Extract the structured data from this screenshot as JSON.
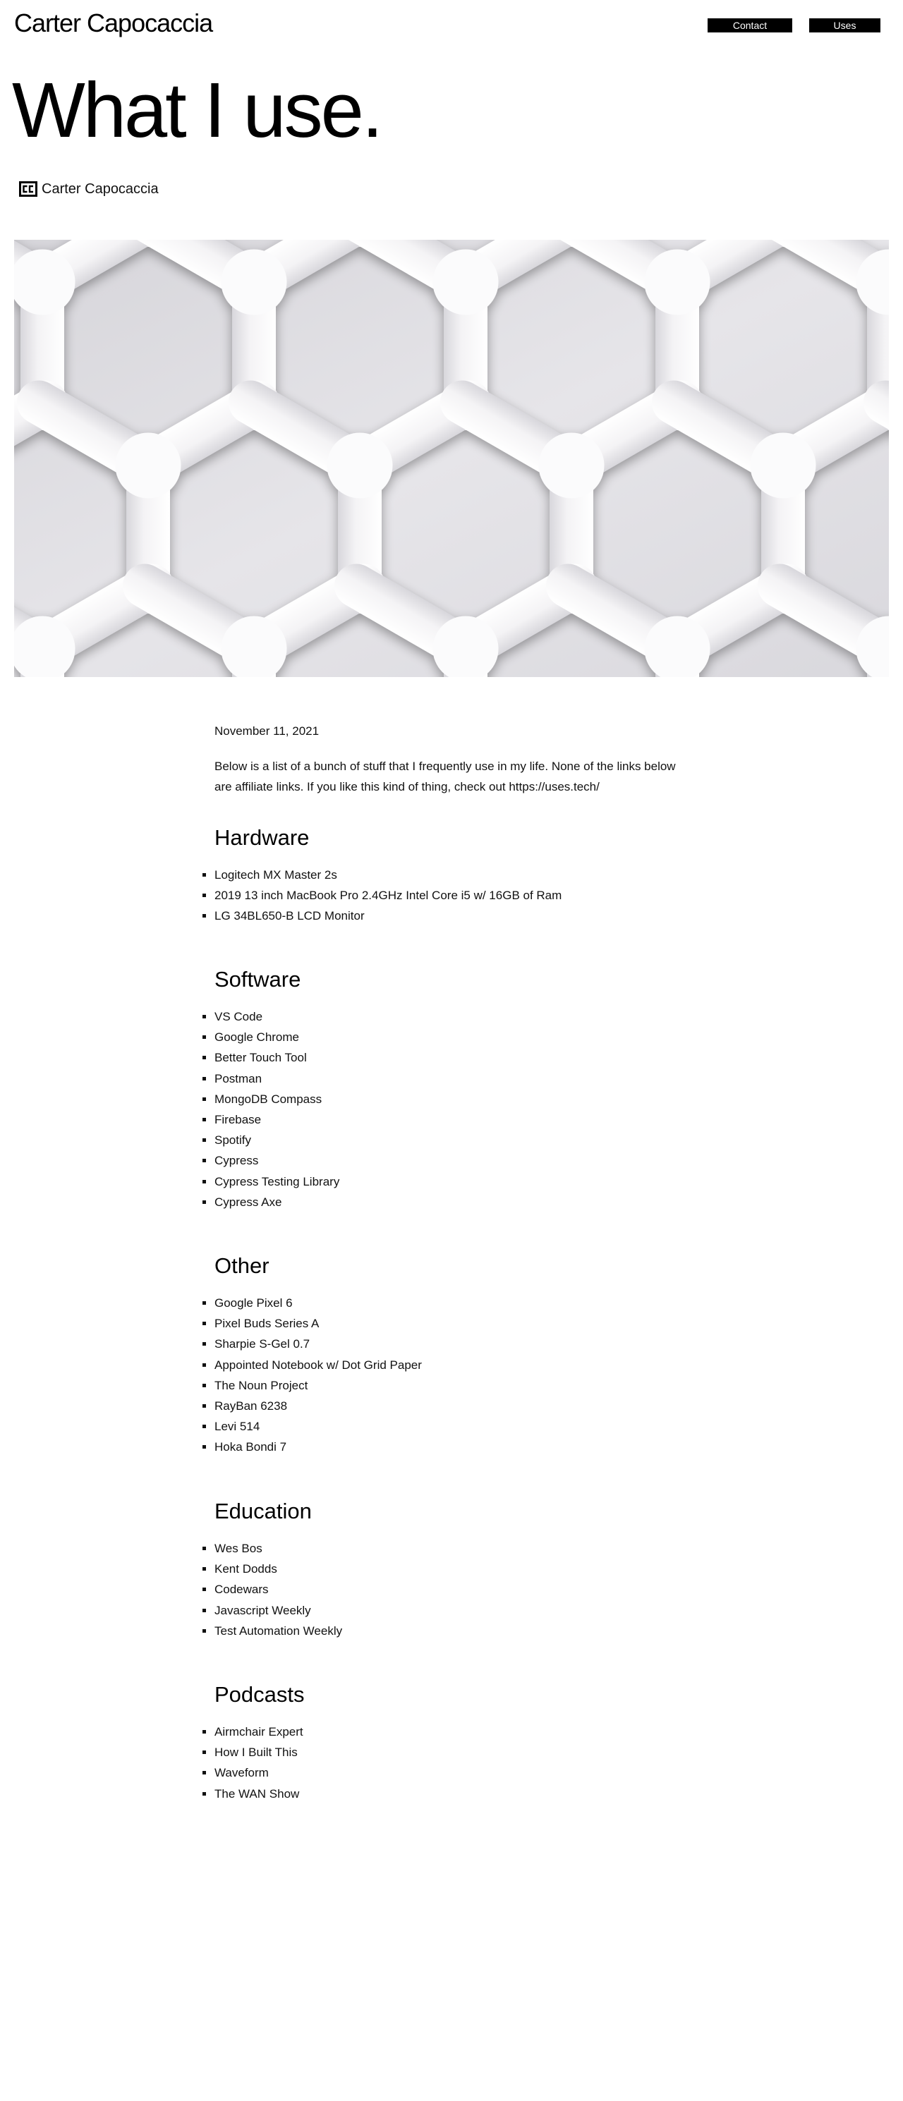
{
  "header": {
    "site_title": "Carter Capocaccia",
    "nav": {
      "contact": "Contact",
      "uses": "Uses"
    }
  },
  "page": {
    "heading": "What I use.",
    "byline": {
      "logo_icon": "cc-monogram-icon",
      "author": "Carter Capocaccia"
    },
    "hero_image": "white woven geometric pattern"
  },
  "post": {
    "date": "November 11, 2021",
    "intro": "Below is a list of a bunch of stuff that I frequently use in my life. None of the links below are affiliate links. If you like this kind of thing, check out https://uses.tech/",
    "sections": [
      {
        "title": "Hardware",
        "items": [
          "Logitech MX Master 2s",
          "2019 13 inch MacBook Pro 2.4GHz Intel Core i5 w/ 16GB of Ram",
          "LG 34BL650-B LCD Monitor"
        ]
      },
      {
        "title": "Software",
        "items": [
          "VS Code",
          "Google Chrome",
          "Better Touch Tool",
          "Postman",
          "MongoDB Compass",
          "Firebase",
          "Spotify",
          "Cypress",
          "Cypress Testing Library",
          "Cypress Axe"
        ]
      },
      {
        "title": "Other",
        "items": [
          "Google Pixel 6",
          "Pixel Buds Series A",
          "Sharpie S-Gel 0.7",
          "Appointed Notebook w/ Dot Grid Paper",
          "The Noun Project",
          "RayBan 6238",
          "Levi 514",
          "Hoka Bondi 7"
        ]
      },
      {
        "title": "Education",
        "items": [
          "Wes Bos",
          "Kent Dodds",
          "Codewars",
          "Javascript Weekly",
          "Test Automation Weekly"
        ]
      },
      {
        "title": "Podcasts",
        "items": [
          "Airmchair Expert",
          "How I Built This",
          "Waveform",
          "The WAN Show"
        ]
      }
    ]
  }
}
